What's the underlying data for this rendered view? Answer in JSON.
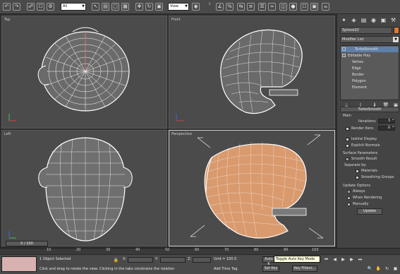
{
  "toolbar": {
    "selection_filter": "All",
    "reference_coord": "View",
    "snap_label": "3",
    "percent_snap_label": "%"
  },
  "viewports": {
    "top_label": "Top",
    "front_label": "Front",
    "left_label": "Left",
    "perspective_label": "Perspective"
  },
  "command_panel": {
    "object_name": "Sphere02",
    "modifier_list": "Modifier List",
    "stack": {
      "turbosmooth": "TurboSmooth",
      "editable_poly": "Editable Poly",
      "sub_objects": [
        "Vertex",
        "Edge",
        "Border",
        "Polygon",
        "Element"
      ]
    },
    "turbosmooth_rollout": {
      "title": "TurboSmooth",
      "main_label": "Main",
      "iterations_label": "Iterations:",
      "iterations_value": "3",
      "render_iters_label": "Render Iters:",
      "render_iters_value": "0",
      "isoline_display": "Isoline Display",
      "explicit_normals": "Explicit Normals",
      "surface_params": "Surface Parameters",
      "smooth_result": "Smooth Result",
      "separate_by": "Separate by:",
      "materials": "Materials",
      "smoothing_groups": "Smoothing Groups",
      "update_options": "Update Options",
      "always": "Always",
      "when_rendering": "When Rendering",
      "manually": "Manually",
      "update_button": "Update"
    }
  },
  "timeline": {
    "slider_label": "0 / 100",
    "ticks": [
      "10",
      "20",
      "30",
      "40",
      "50",
      "60",
      "70",
      "80",
      "90",
      "100"
    ]
  },
  "status": {
    "selection_info": "1 Object Selected",
    "prompt": "Click and drag to rotate the view.  Clicking in the tabs constrains the rotation",
    "x_label": "X:",
    "y_label": "Y:",
    "z_label": "Z:",
    "grid": "Grid = 100.0",
    "add_time_tag": "Add Time Tag",
    "auto_key": "Auto K",
    "set_key": "Set Key",
    "key_filters": "Key Filters...",
    "tooltip": "Toggle Auto Key Mode"
  },
  "colors": {
    "viewport_bg": "#4b4b4b",
    "wireframe": "#ffffff",
    "shaded_object": "#d99a6e",
    "selection_highlight": "#5d7fa8",
    "object_color": "#e07a34"
  }
}
